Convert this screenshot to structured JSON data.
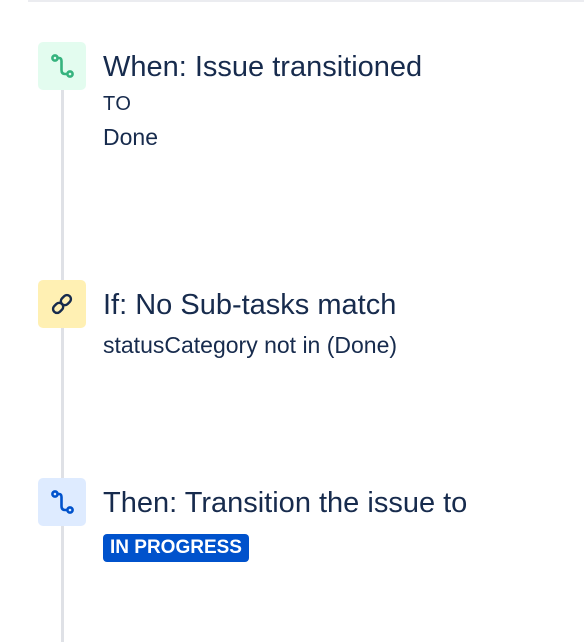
{
  "rule": {
    "trigger": {
      "icon": "branch-icon",
      "title": "When: Issue transitioned",
      "label": "TO",
      "value": "Done",
      "color": "#36b37e"
    },
    "condition": {
      "icon": "link-icon",
      "title": "If: No Sub-tasks match",
      "detail": "statusCategory not in (Done)",
      "color": "#ffab00"
    },
    "action": {
      "icon": "branch-icon",
      "title": "Then: Transition the issue to",
      "status": "IN PROGRESS",
      "color": "#0052cc"
    }
  }
}
